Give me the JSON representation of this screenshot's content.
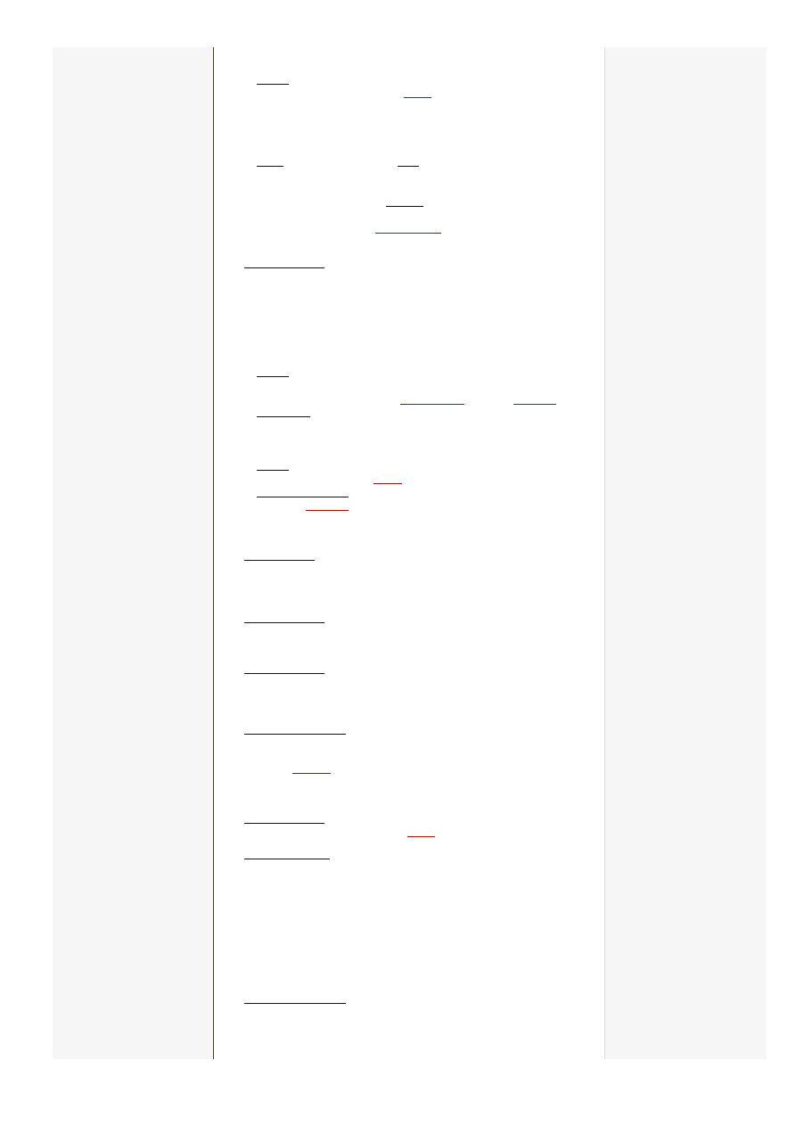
{
  "colors": {
    "page_background": "#f7f6f7",
    "content_background": "#ffffff",
    "margin_rule": "#a01010",
    "right_rule": "#dcdcdc",
    "text_underline": "#111111",
    "link_underline": "#a01010"
  }
}
